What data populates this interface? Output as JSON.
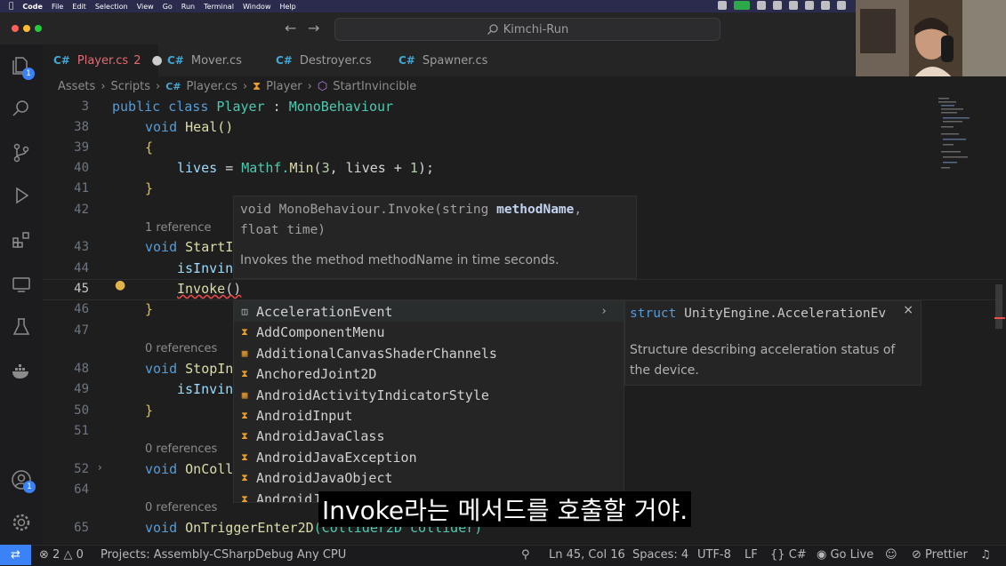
{
  "menubar": {
    "app": "Code",
    "items": [
      "File",
      "Edit",
      "Selection",
      "View",
      "Go",
      "Run",
      "Terminal",
      "Window",
      "Help"
    ]
  },
  "titlebar": {
    "search": "Kimchi-Run"
  },
  "tabs": [
    {
      "label": "Player.cs",
      "badge": "2",
      "modified": true,
      "active": true
    },
    {
      "label": "Mover.cs"
    },
    {
      "label": "Destroyer.cs"
    },
    {
      "label": "Spawner.cs"
    }
  ],
  "activity_badges": {
    "explorer": "1",
    "account": "1"
  },
  "breadcrumb": [
    "Assets",
    "Scripts",
    "Player.cs",
    "Player",
    "StartInvincible"
  ],
  "editor": {
    "line_numbers": [
      "3",
      "38",
      "39",
      "40",
      "41",
      "42",
      "43",
      "44",
      "45",
      "46",
      "47",
      "48",
      "49",
      "50",
      "51",
      "52",
      "64",
      "65"
    ],
    "references": {
      "r43": "1 reference",
      "r48": "0 references",
      "r52": "0 references",
      "r65": "0 references"
    },
    "lines": {
      "l3": [
        "public",
        "class",
        "Player",
        ":",
        "MonoBehaviour"
      ],
      "l38": [
        "void",
        "Heal()"
      ],
      "l39": "{",
      "l40": [
        "lives",
        "=",
        "Mathf.",
        "Min",
        "(",
        "3",
        ", lives + ",
        "1",
        ");"
      ],
      "l41": "}",
      "l43": [
        "void",
        "StartI"
      ],
      "l44": "isInvin",
      "l45": [
        "Invoke",
        "()"
      ],
      "l46": "}",
      "l48": [
        "void",
        "StopIn"
      ],
      "l49": "isInvin",
      "l50": "}",
      "l52": [
        "void",
        "OnColl"
      ],
      "l65": [
        "void",
        "OnTriggerEnter2D",
        "(Collider2D collider)"
      ]
    }
  },
  "hover": {
    "sig_pre": "void MonoBehaviour.Invoke(string ",
    "sig_param": "methodName",
    "sig_post": ",",
    "sig_line2": "float time)",
    "desc": "Invokes the method methodName in time seconds."
  },
  "suggestions": [
    "AccelerationEvent",
    "AddComponentMenu",
    "AdditionalCanvasShaderChannels",
    "AnchoredJoint2D",
    "AndroidActivityIndicatorStyle",
    "AndroidInput",
    "AndroidJavaClass",
    "AndroidJavaException",
    "AndroidJavaObject",
    "AndroidJ"
  ],
  "details": {
    "title_kw": "struct",
    "title": "UnityEngine.AccelerationEv",
    "desc": "Structure describing acceleration status of the device."
  },
  "subtitle": "Invoke라는 메서드를 호출할 거야.",
  "status": {
    "errors": "2",
    "warnings": "0",
    "project": "Projects: Assembly-CSharp",
    "debug": "Debug Any CPU",
    "cursor": "Ln 45, Col 16",
    "spaces": "Spaces: 4",
    "encoding": "UTF-8",
    "eol": "LF",
    "language": "C#",
    "golive": "Go Live",
    "prettier": "Prettier"
  },
  "colors": {
    "accent": "#3b82f6",
    "keyword": "#569cd6",
    "type": "#4ec9b0",
    "function": "#dcdcaa",
    "number": "#b5cea8"
  }
}
